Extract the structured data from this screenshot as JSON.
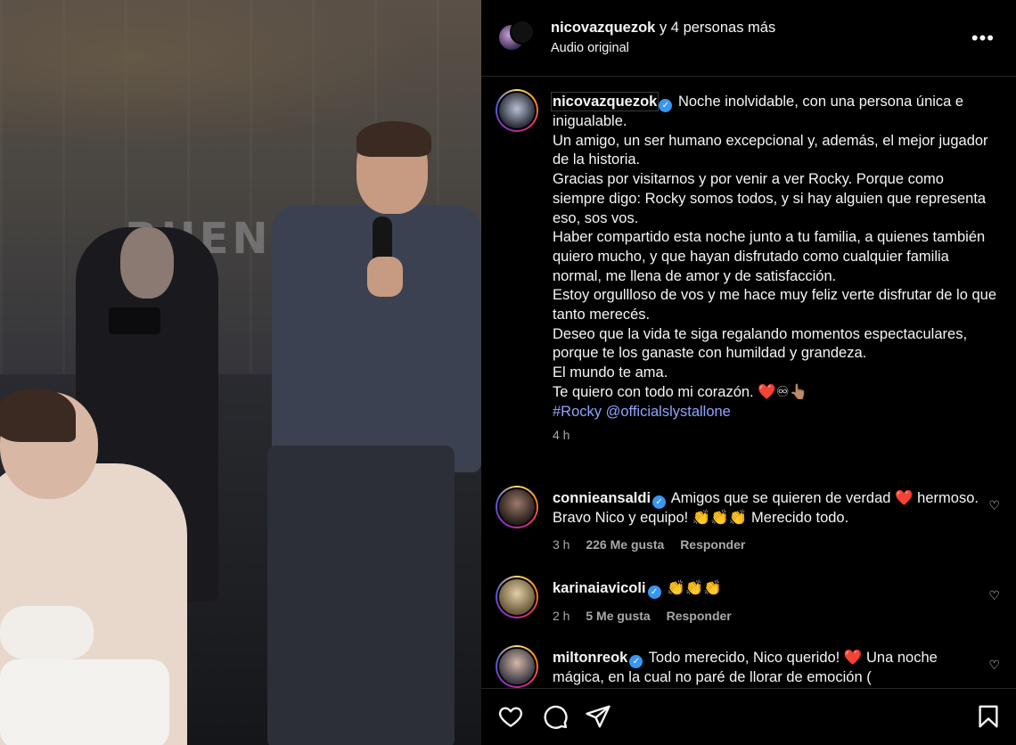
{
  "header": {
    "username": "nicovazquezok",
    "with_text": "y 4 personas más",
    "audio": "Audio original",
    "more_glyph": "•••"
  },
  "caption": {
    "username": "nicovazquezok",
    "verified_glyph": "✓",
    "lines": [
      "Noche inolvidable, con una persona única e inigualable.",
      "Un amigo, un ser humano excepcional y, además, el mejor jugador de la historia.",
      "Gracias por visitarnos y por venir a ver Rocky. Porque como siempre digo: Rocky somos todos, y si hay alguien que representa eso, sos vos.",
      "Haber compartido esta noche junto a tu familia, a quienes también quiero mucho, y que hayan disfrutado como cualquier familia normal, me llena de amor y de satisfacción.",
      "Estoy orgullloso de vos y me hace muy feliz verte disfrutar de lo que tanto merecés.",
      "Deseo que la vida te siga regalando momentos espectaculares, porque te los ganaste con humildad y grandeza.",
      "El mundo te ama.",
      "Te quiero con todo mi corazón. ❤️♾👆🏽"
    ],
    "tags": "#Rocky @officialslystallone",
    "time": "4 h"
  },
  "comments": [
    {
      "username": "connieansaldi",
      "text": "Amigos que se quieren de verdad ❤️ hermoso. Bravo Nico y equipo! 👏👏👏 Merecido todo.",
      "time": "3 h",
      "likes": "226 Me gusta",
      "reply": "Responder"
    },
    {
      "username": "karinaiavicoli",
      "text": "👏👏👏",
      "time": "2 h",
      "likes": "5 Me gusta",
      "reply": "Responder"
    },
    {
      "username": "miltonreok",
      "text": "Todo merecido, Nico querido! ❤️ Una noche mágica, en la cual no paré de llorar de emoción (",
      "time": "",
      "likes": "",
      "reply": ""
    }
  ],
  "media": {
    "sign_text": "BUENOS"
  },
  "icons": {
    "like": "heart-icon",
    "comment": "comment-icon",
    "share": "share-icon",
    "save": "bookmark-icon",
    "comment_heart_glyph": "♡"
  },
  "colors": {
    "background": "#000000",
    "text": "#f5f5f5",
    "muted": "#a8a8a8",
    "link": "#8fa3ff",
    "verified": "#3897f0"
  }
}
